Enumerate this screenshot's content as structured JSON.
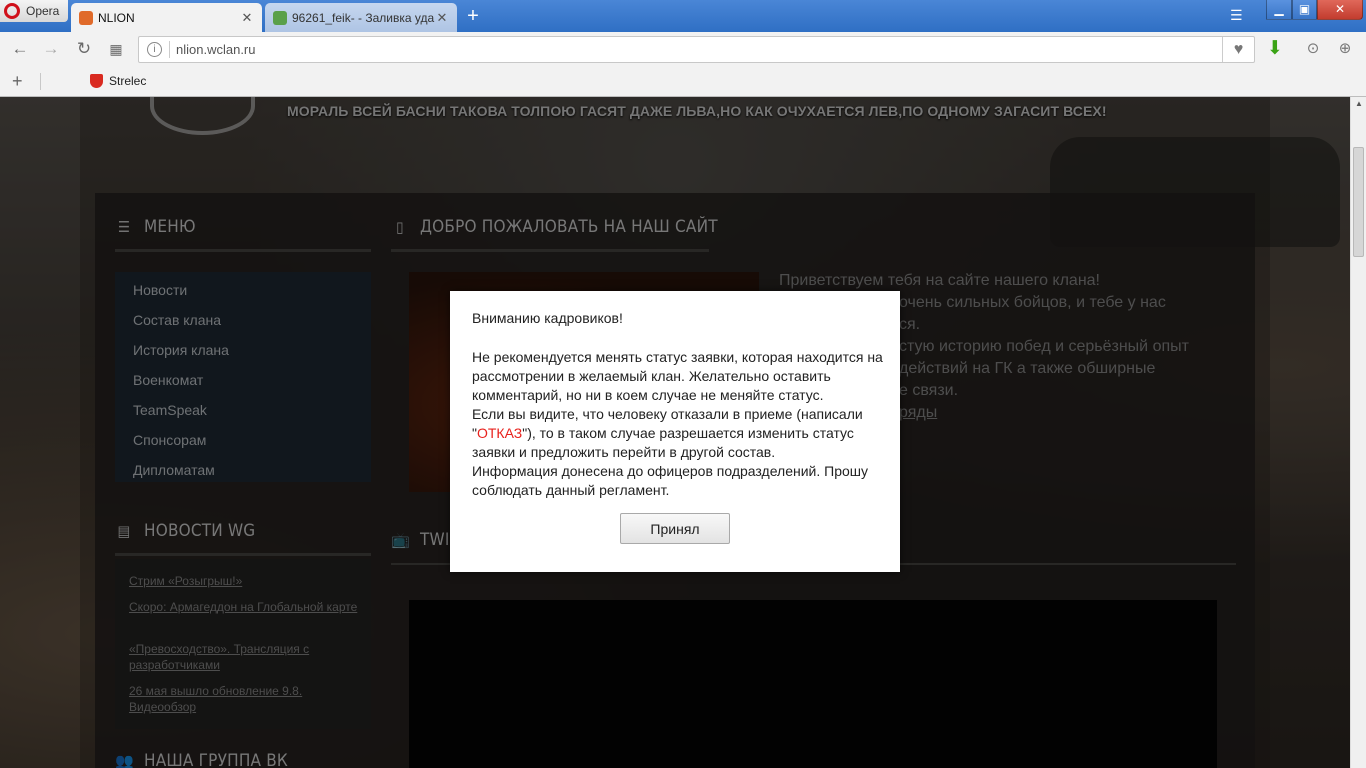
{
  "browser": {
    "menu_label": "Opera",
    "tabs": [
      {
        "title": "NLION",
        "favicon_color": "#e06a2a"
      },
      {
        "title": "96261_feik- - Заливка уда",
        "favicon_color": "#5aa04a"
      }
    ],
    "url": "nlion.wclan.ru",
    "bookmarks": [
      {
        "label": "Strelec"
      }
    ],
    "accent": "#2f6fc4"
  },
  "page": {
    "slogan": "МОРАЛЬ ВСЕЙ БАСНИ ТАКОВА ТОЛПОЮ ГАСЯТ ДАЖЕ ЛЬВА,НО КАК ОЧУХАЕТСЯ ЛЕВ,ПО ОДНОМУ ЗАГАСИТ ВСЕХ!",
    "menu": {
      "title": "МЕНЮ",
      "items": [
        "Новости",
        "Состав клана",
        "История клана",
        "Военкомат",
        "TeamSpeak",
        "Спонсорам",
        "Дипломатам"
      ]
    },
    "news": {
      "title": "НОВОСТИ WG",
      "items": [
        "Стрим «Розыгрыш!»",
        "Скоро: Армагеддон на Глобальной карте",
        "«Превосходство». Трансляция с разработчиками",
        "26 мая вышло обновление 9.8. Видеообзор"
      ]
    },
    "vk_title": "НАША ГРУППА ВК",
    "welcome": {
      "title": "ДОБРО ПОЖАЛОВАТЬ НА НАШ САЙТ",
      "lines": [
        "Приветствуем тебя на сайте нашего клана!",
        "очень сильных бойцов, и тебе у нас",
        "ся.",
        "стую историю побед и серьёзный опыт",
        "действий на ГК а также обширные",
        "е связи."
      ],
      "link": "ряды"
    },
    "twitch_title": "TWI"
  },
  "modal": {
    "heading": "Вниманию кадровиков!",
    "para1": "Не рекомендуется менять статус заявки, которая находится на рассмотрении в желаемый клан. Желательно оставить комментарий, но ни в коем случае не меняйте статус.",
    "para2_before": "Если вы видите, что человеку отказали в приеме (написали \"",
    "para2_red": "ОТКАЗ",
    "para2_after": "\"), то в таком случае разрешается изменить статус заявки и предложить перейти в другой состав.",
    "para3": "Информация донесена до офицеров подразделений. Прошу соблюдать данный регламент.",
    "button": "Принял",
    "highlight_color": "#e8211c"
  }
}
